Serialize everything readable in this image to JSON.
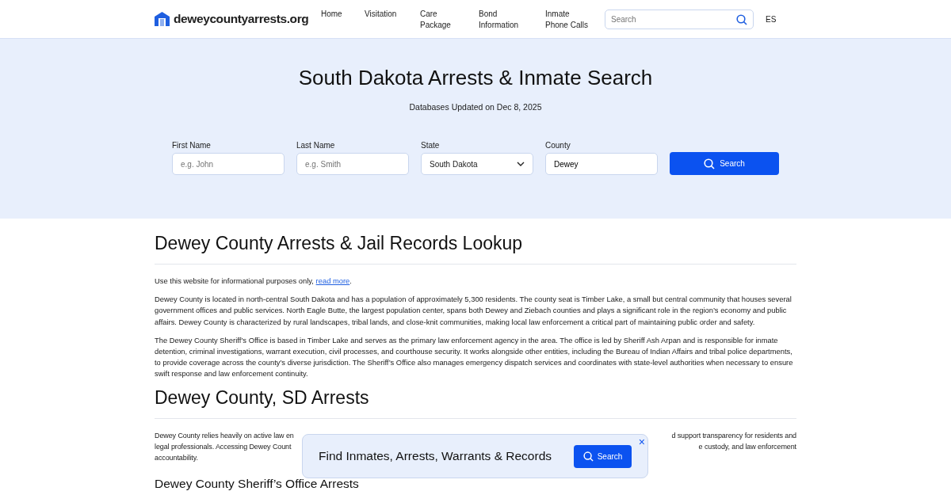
{
  "header": {
    "logo": "deweycountyarrests.org",
    "nav": [
      {
        "label": "Home"
      },
      {
        "label": "Visitation"
      },
      {
        "label": "Care Package"
      },
      {
        "label": "Bond Information"
      },
      {
        "label": "Inmate Phone Calls"
      }
    ],
    "search": {
      "placeholder": "Search"
    },
    "language": "ES"
  },
  "hero": {
    "title": "South Dakota Arrests & Inmate Search",
    "updated": "Databases Updated on Dec 8, 2025",
    "fields": [
      {
        "kind": "input",
        "label": "First Name",
        "placeholder": "e.g. John"
      },
      {
        "kind": "input",
        "label": "Last Name",
        "placeholder": "e.g. Smith"
      },
      {
        "kind": "select",
        "label": "State",
        "value": "South Dakota"
      },
      {
        "kind": "input",
        "label": "County",
        "value": "Dewey"
      }
    ],
    "button": "Search"
  },
  "article": {
    "title": "Dewey County Arrests & Jail Records Lookup",
    "notice": "Use this website for informational purposes only, ",
    "notice_link": "read more",
    "notice_end": ".",
    "paragraphs": [
      "Dewey County is located in north-central South Dakota and has a population of approximately 5,300 residents. The county seat is Timber Lake, a small but central community that houses several government offices and public services. North Eagle Butte, the largest population center, spans both Dewey and Ziebach counties and plays a significant role in the region’s economy and public affairs. Dewey County is characterized by rural landscapes, tribal lands, and close-knit communities, making local law enforcement a critical part of maintaining public order and safety.",
      "The Dewey County Sheriff’s Office is based in Timber Lake and serves as the primary law enforcement agency in the area. The office is led by Sheriff Ash Arpan and is responsible for inmate detention, criminal investigations, warrant execution, civil processes, and courthouse security. It works alongside other entities, including the Bureau of Indian Affairs and tribal police departments, to provide coverage across the county’s diverse jurisdiction. The Sheriff’s Office also manages emergency dispatch services and coordinates with state-level authorities when necessary to ensure swift response and law enforcement continuity."
    ],
    "section_title": "Dewey County, SD Arrests",
    "covered_lines": [
      {
        "left": "Dewey County relies heavily on active law en",
        "right": "d support transparency for residents and"
      },
      {
        "left": "legal professionals. Accessing Dewey Count",
        "right": "e custody, and law enforcement"
      },
      {
        "left": "accountability."
      }
    ],
    "next_title": "Dewey County Sheriff’s Office Arrests"
  },
  "popup": {
    "text": "Find Inmates, Arrests, Warrants & Records",
    "button": "Search",
    "close": "×"
  }
}
